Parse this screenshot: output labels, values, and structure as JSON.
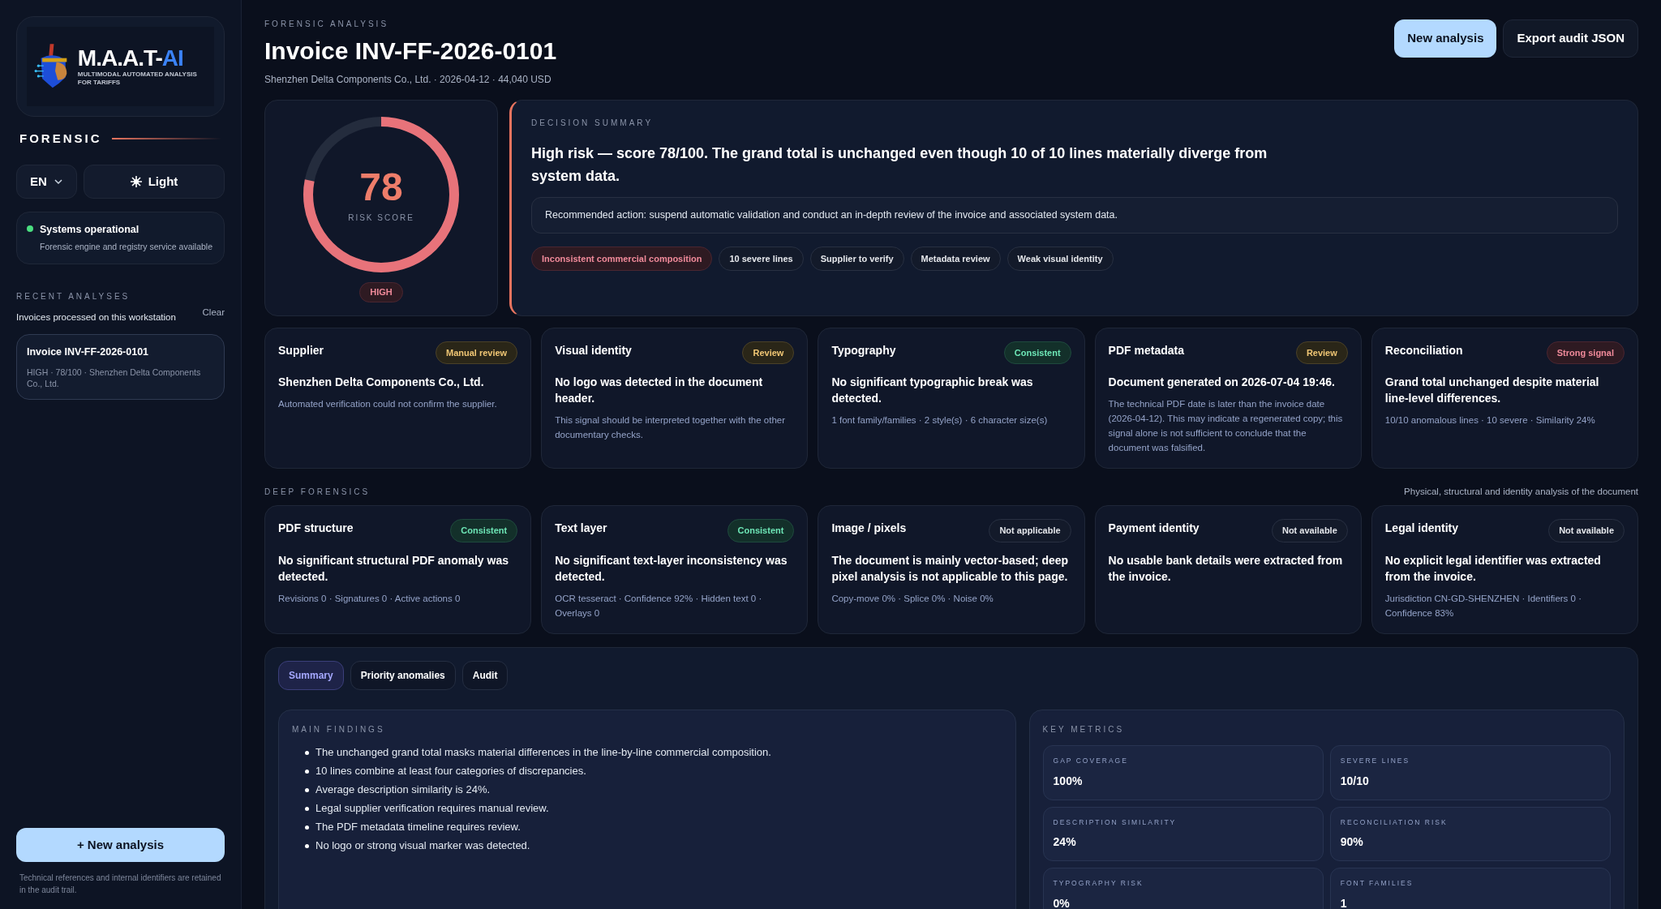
{
  "sidebar": {
    "logo": {
      "name_main": "M.A.A.T-",
      "name_accent": "AI",
      "tagline": "MULTIMODAL AUTOMATED ANALYSIS FOR TARIFFS"
    },
    "section_title": "FORENSIC",
    "language": "EN",
    "theme_button": "Light",
    "status": {
      "title": "Systems operational",
      "detail": "Forensic engine and registry service available",
      "color": "#4ade80"
    },
    "recent": {
      "label": "RECENT ANALYSES",
      "subtitle": "Invoices processed on this workstation",
      "clear": "Clear",
      "items": [
        {
          "title": "Invoice INV-FF-2026-0101",
          "detail": "HIGH · 78/100 · Shenzhen Delta Components Co., Ltd.",
          "selected": true
        }
      ]
    },
    "new_button": "+ New analysis",
    "footnote": "Technical references and internal identifiers are retained in the audit trail."
  },
  "header": {
    "eyebrow": "FORENSIC ANALYSIS",
    "title": "Invoice INV-FF-2026-0101",
    "subtitle": "Shenzhen Delta Components Co., Ltd. · 2026-04-12 · 44,040 USD",
    "buttons": [
      {
        "label": "New analysis",
        "kind": "primary"
      },
      {
        "label": "Export audit JSON",
        "kind": "secondary"
      }
    ]
  },
  "score": {
    "value": "78",
    "label": "RISK SCORE",
    "level": 0.78,
    "grade": "HIGH"
  },
  "decision": {
    "eyebrow": "DECISION SUMMARY",
    "headline": "High risk — score 78/100. The grand total is unchanged even though 10 of 10 lines materially diverge from system data.",
    "action": "Recommended action: suspend automatic validation and conduct an in-depth review of the invoice and associated system data.",
    "tags": [
      {
        "label": "Inconsistent commercial composition",
        "kind": "danger"
      },
      {
        "label": "10 severe lines",
        "kind": "neutral"
      },
      {
        "label": "Supplier to verify",
        "kind": "neutral"
      },
      {
        "label": "Metadata review",
        "kind": "neutral"
      },
      {
        "label": "Weak visual identity",
        "kind": "neutral"
      }
    ]
  },
  "signal_cards": [
    {
      "title": "Supplier",
      "badge": "Manual review",
      "kind": "warn",
      "finding": "Shenzhen Delta Components Co., Ltd.",
      "detail": "Automated verification could not confirm the supplier."
    },
    {
      "title": "Visual identity",
      "badge": "Review",
      "kind": "warn",
      "finding": "No logo was detected in the document header.",
      "detail": "This signal should be interpreted together with the other documentary checks."
    },
    {
      "title": "Typography",
      "badge": "Consistent",
      "kind": "ok",
      "finding": "No significant typographic break was detected.",
      "detail": "1 font family/families · 2 style(s) · 6 character size(s)"
    },
    {
      "title": "PDF metadata",
      "badge": "Review",
      "kind": "warn",
      "finding": "Document generated on 2026-07-04 19:46.",
      "detail": "The technical PDF date is later than the invoice date (2026-04-12). This may indicate a regenerated copy; this signal alone is not sufficient to conclude that the document was falsified."
    },
    {
      "title": "Reconciliation",
      "badge": "Strong signal",
      "kind": "danger",
      "finding": "Grand total unchanged despite material line-level differences.",
      "detail": "10/10 anomalous lines · 10 severe · Similarity 24%"
    }
  ],
  "deep_forensics": {
    "label": "DEEP FORENSICS",
    "caption": "Physical, structural and identity analysis of the document",
    "cards": [
      {
        "title": "PDF structure",
        "badge": "Consistent",
        "kind": "ok",
        "finding": "No significant structural PDF anomaly was detected.",
        "detail": "Revisions 0 · Signatures 0 · Active actions 0"
      },
      {
        "title": "Text layer",
        "badge": "Consistent",
        "kind": "ok",
        "finding": "No significant text-layer inconsistency was detected.",
        "detail": "OCR tesseract · Confidence 92% · Hidden text 0 · Overlays 0"
      },
      {
        "title": "Image / pixels",
        "badge": "Not applicable",
        "kind": "neutral",
        "finding": "The document is mainly vector-based; deep pixel analysis is not applicable to this page.",
        "detail": "Copy-move 0% · Splice 0% · Noise 0%"
      },
      {
        "title": "Payment identity",
        "badge": "Not available",
        "kind": "neutral",
        "finding": "No usable bank details were extracted from the invoice."
      },
      {
        "title": "Legal identity",
        "badge": "Not available",
        "kind": "neutral",
        "finding": "No explicit legal identifier was extracted from the invoice.",
        "detail": "Jurisdiction CN-GD-SHENZHEN · Identifiers 0 · Confidence 83%"
      }
    ]
  },
  "tabs": [
    {
      "label": "Summary",
      "selected": true
    },
    {
      "label": "Priority anomalies",
      "selected": false
    },
    {
      "label": "Audit",
      "selected": false
    }
  ],
  "main_findings": {
    "label": "MAIN FINDINGS",
    "items": [
      "The unchanged grand total masks material differences in the line-by-line commercial composition.",
      "10 lines combine at least four categories of discrepancies.",
      "Average description similarity is 24%.",
      "Legal supplier verification requires manual review.",
      "The PDF metadata timeline requires review.",
      "No logo or strong visual marker was detected."
    ]
  },
  "key_metrics": {
    "label": "KEY METRICS",
    "items": [
      {
        "label": "GAP COVERAGE",
        "value": "100%"
      },
      {
        "label": "SEVERE LINES",
        "value": "10/10"
      },
      {
        "label": "DESCRIPTION SIMILARITY",
        "value": "24%"
      },
      {
        "label": "RECONCILIATION RISK",
        "value": "90%"
      },
      {
        "label": "TYPOGRAPHY RISK",
        "value": "0%"
      },
      {
        "label": "FONT FAMILIES",
        "value": "1"
      }
    ]
  }
}
